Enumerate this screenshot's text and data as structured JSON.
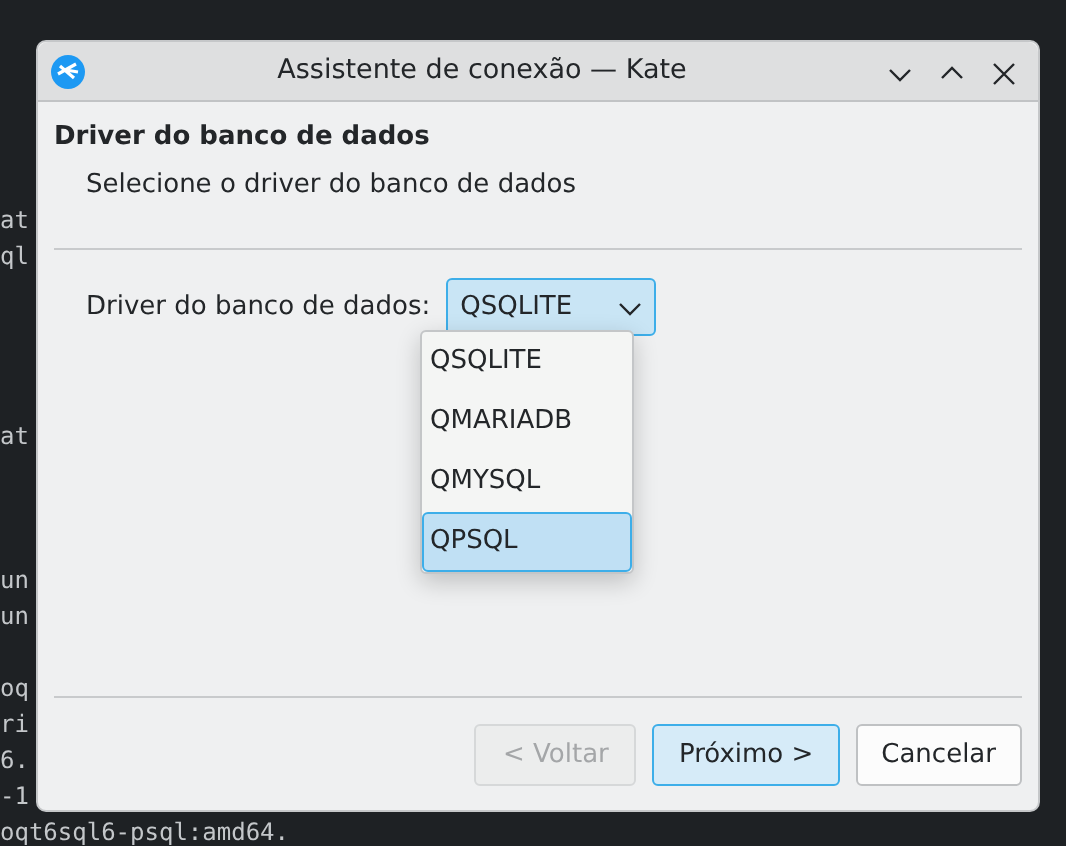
{
  "terminal": {
    "lines": [
      {
        "text": "at"
      },
      {
        "text": "ql"
      },
      {
        "text": "at"
      },
      {
        "text": "un"
      },
      {
        "text": "un"
      },
      {
        "text": "oq"
      },
      {
        "text": "ri"
      },
      {
        "text": "6."
      },
      {
        "text": "-1"
      },
      {
        "text": "oqt6sql6-psql:amd64."
      }
    ]
  },
  "window": {
    "title": "Assistente de conexão — Kate"
  },
  "page": {
    "heading": "Driver do banco de dados",
    "subtitle": "Selecione o driver do banco de dados"
  },
  "driver_field": {
    "label": "Driver do banco de dados:",
    "value": "QSQLITE"
  },
  "dropdown": {
    "options": [
      {
        "label": "QSQLITE",
        "selected": false
      },
      {
        "label": "QMARIADB",
        "selected": false
      },
      {
        "label": "QMYSQL",
        "selected": false
      },
      {
        "label": "QPSQL",
        "selected": true
      }
    ]
  },
  "buttons": [
    {
      "label": "< Voltar",
      "kind": "normal",
      "disabled": true
    },
    {
      "label": "Próximo >",
      "kind": "default",
      "disabled": false
    },
    {
      "label": "Cancelar",
      "kind": "normal",
      "disabled": false
    }
  ]
}
